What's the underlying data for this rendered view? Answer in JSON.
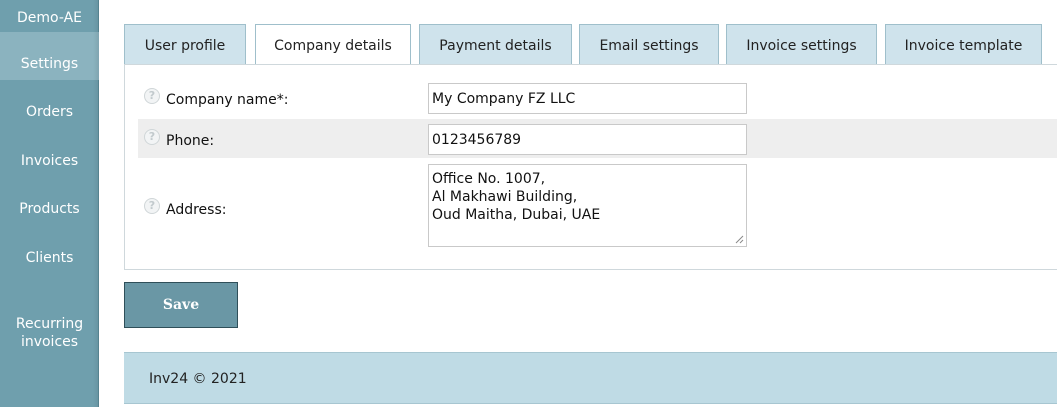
{
  "sidebar": {
    "brand": "Demo-AE",
    "items": [
      {
        "label": "Settings",
        "active": true
      },
      {
        "label": "Orders"
      },
      {
        "label": "Invoices"
      },
      {
        "label": "Products"
      },
      {
        "label": "Clients"
      },
      {
        "label": "Recurring\ninvoices"
      }
    ]
  },
  "tabs": [
    {
      "label": "User profile"
    },
    {
      "label": "Company details",
      "active": true
    },
    {
      "label": "Payment details"
    },
    {
      "label": "Email settings"
    },
    {
      "label": "Invoice settings"
    },
    {
      "label": "Invoice template"
    }
  ],
  "form": {
    "company_name": {
      "label": "Company name*:",
      "value": "My Company FZ LLC"
    },
    "phone": {
      "label": "Phone:",
      "value": "0123456789"
    },
    "address": {
      "label": "Address:",
      "value": "Office No. 1007,\nAl Makhawi Building,\nOud Maitha, Dubai, UAE"
    }
  },
  "help_icon_glyph": "?",
  "actions": {
    "save_label": "Save"
  },
  "footer": {
    "copyright": "Inv24 © 2021"
  },
  "colors": {
    "sidebar_bg": "#6f9fad",
    "sidebar_active": "#8bb3bf",
    "tab_bg": "#cfe3ec",
    "footer_bg": "#bfdbe5",
    "save_bg": "#6a97a5"
  }
}
